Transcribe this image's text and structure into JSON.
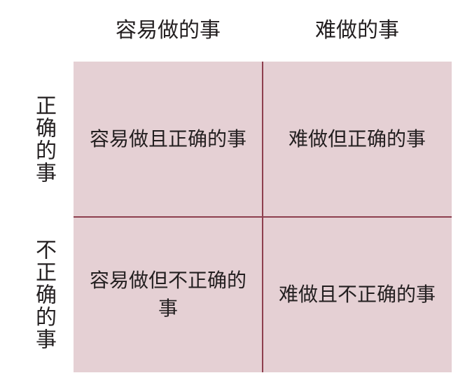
{
  "columns": [
    "容易做的事",
    "难做的事"
  ],
  "rows": [
    "正确的事",
    "不正确的事"
  ],
  "cells": [
    [
      "容易做且正确的事",
      "难做但正确的事"
    ],
    [
      "容易做但不正确的事",
      "难做且不正确的事"
    ]
  ],
  "colors": {
    "cell_fill": "#e5d0d4",
    "divider": "#8d3f4e",
    "text": "#231f20"
  }
}
